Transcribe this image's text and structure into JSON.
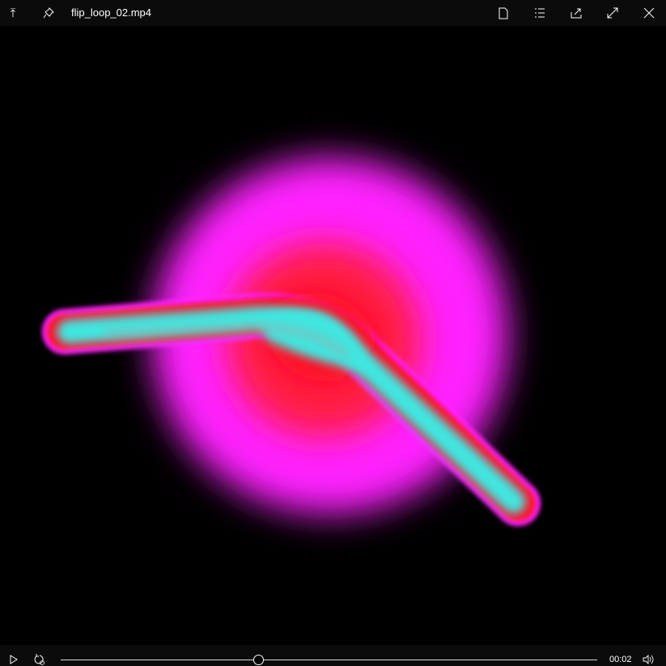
{
  "header": {
    "title": "flip_loop_02.mp4"
  },
  "icons": {
    "top_left": [
      "keep-on-top-icon",
      "pin-icon"
    ],
    "top_right": [
      "file-icon",
      "playlist-icon",
      "share-icon",
      "fullscreen-icon",
      "close-icon"
    ],
    "bottom": [
      "play-icon",
      "repeat-icon",
      "volume-icon"
    ]
  },
  "player": {
    "time": "00:02",
    "progress": 0.368
  },
  "colors": {
    "bar": "#0b0b0b",
    "glow_outer": "#ff22ff",
    "glow_inner": "#ff1a2e",
    "core": "#3fe6e0"
  }
}
